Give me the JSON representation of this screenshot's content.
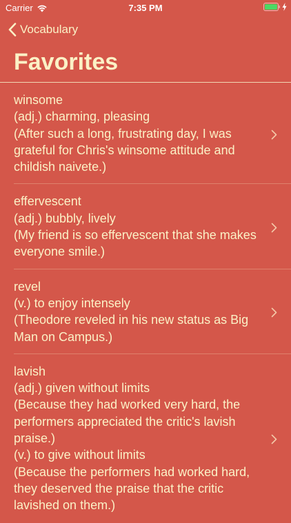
{
  "status_bar": {
    "carrier": "Carrier",
    "time": "7:35 PM",
    "battery_color": "#4cd964"
  },
  "nav": {
    "back_label": "Vocabulary"
  },
  "page": {
    "title": "Favorites"
  },
  "colors": {
    "background": "#d4574a",
    "text": "#fbf1c6"
  },
  "entries": [
    {
      "lines": [
        "winsome",
        "(adj.) charming, pleasing",
        "(After such a long, frustrating day, I was grateful for Chris's winsome attitude and childish naivete.)"
      ]
    },
    {
      "lines": [
        "effervescent",
        "(adj.) bubbly, lively",
        "(My friend is so effervescent that she makes everyone smile.)"
      ]
    },
    {
      "lines": [
        "revel",
        "(v.) to enjoy intensely",
        "(Theodore reveled in his new status as Big Man on Campus.)"
      ]
    },
    {
      "lines": [
        "lavish",
        "(adj.) given without limits",
        "(Because they had worked very hard, the performers appreciated the critic's lavish praise.)",
        "(v.) to give without limits",
        "(Because the performers had worked hard, they deserved the praise that the critic lavished on them.)"
      ]
    }
  ]
}
